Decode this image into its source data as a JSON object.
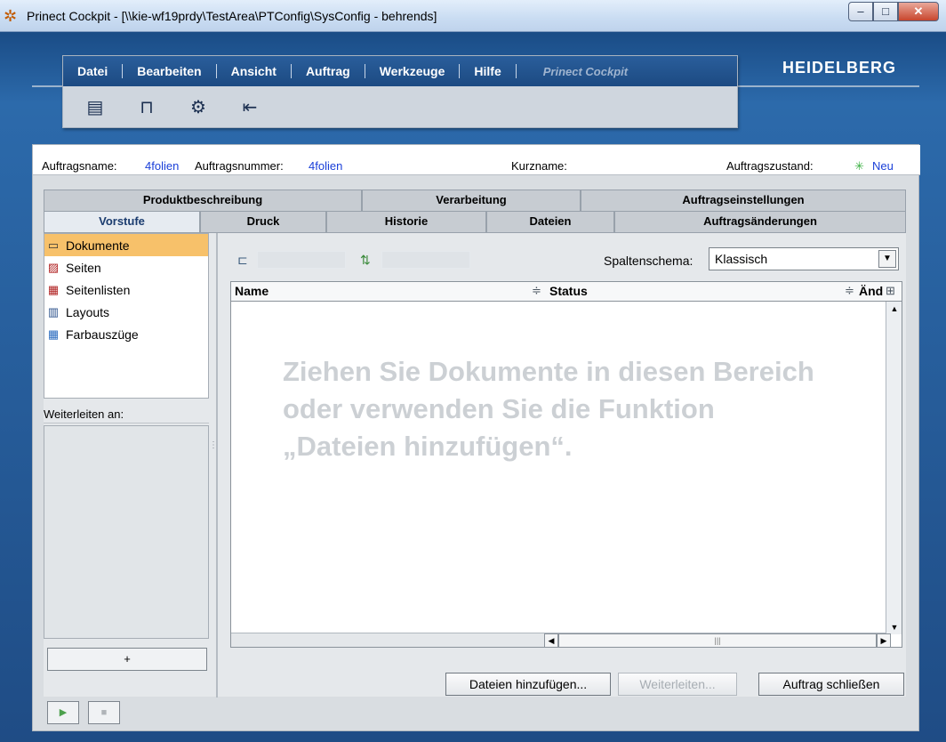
{
  "window": {
    "title": "Prinect Cockpit - [\\\\kie-wf19prdy\\TestArea\\PTConfig\\SysConfig - behrends]",
    "controls": {
      "minimize": "–",
      "maximize": "□",
      "close": "✕"
    }
  },
  "menu": {
    "items": [
      "Datei",
      "Bearbeiten",
      "Ansicht",
      "Auftrag",
      "Werkzeuge",
      "Hilfe"
    ],
    "brand_text": "Prinect Cockpit",
    "logo": "HEIDELBERG",
    "toolbar_icons": [
      "document-abc-icon",
      "job-icon",
      "computer-settings-icon",
      "document-import-icon"
    ]
  },
  "info": {
    "auftragsname_label": "Auftragsname:",
    "auftragsname_value": "4folien",
    "auftragsnummer_label": "Auftragsnummer:",
    "auftragsnummer_value": "4folien",
    "kurzname_label": "Kurzname:",
    "kurzname_value": "",
    "zustand_label": "Auftragszustand:",
    "zustand_value": "Neu",
    "zustand_color": "#3cb043"
  },
  "tabs": {
    "row1": [
      "Produktbeschreibung",
      "Verarbeitung",
      "Auftragseinstellungen"
    ],
    "row2": [
      "Vorstufe",
      "Druck",
      "Historie",
      "Dateien",
      "Auftragsänderungen"
    ],
    "active": "Vorstufe"
  },
  "nav": {
    "items": [
      "Dokumente",
      "Seiten",
      "Seitenlisten",
      "Layouts",
      "Farbauszüge"
    ],
    "selected": "Dokumente",
    "forward_label": "Weiterleiten an:",
    "add_label": "+"
  },
  "filter": {
    "schema_label": "Spaltenschema:",
    "schema_value": "Klassisch"
  },
  "table": {
    "columns": [
      "Name",
      "Status",
      "Änd"
    ],
    "empty_hint": "Ziehen Sie Dokumente in diesen Bereich oder verwenden Sie die Funktion „Dateien hinzufügen“."
  },
  "buttons": {
    "add_files": "Dateien hinzufügen...",
    "forward": "Weiterleiten...",
    "close_job": "Auftrag schließen"
  },
  "colors": {
    "accent_blue": "#1a3fd8",
    "selection": "#f7c16a",
    "app_background": "#1f4c85"
  }
}
